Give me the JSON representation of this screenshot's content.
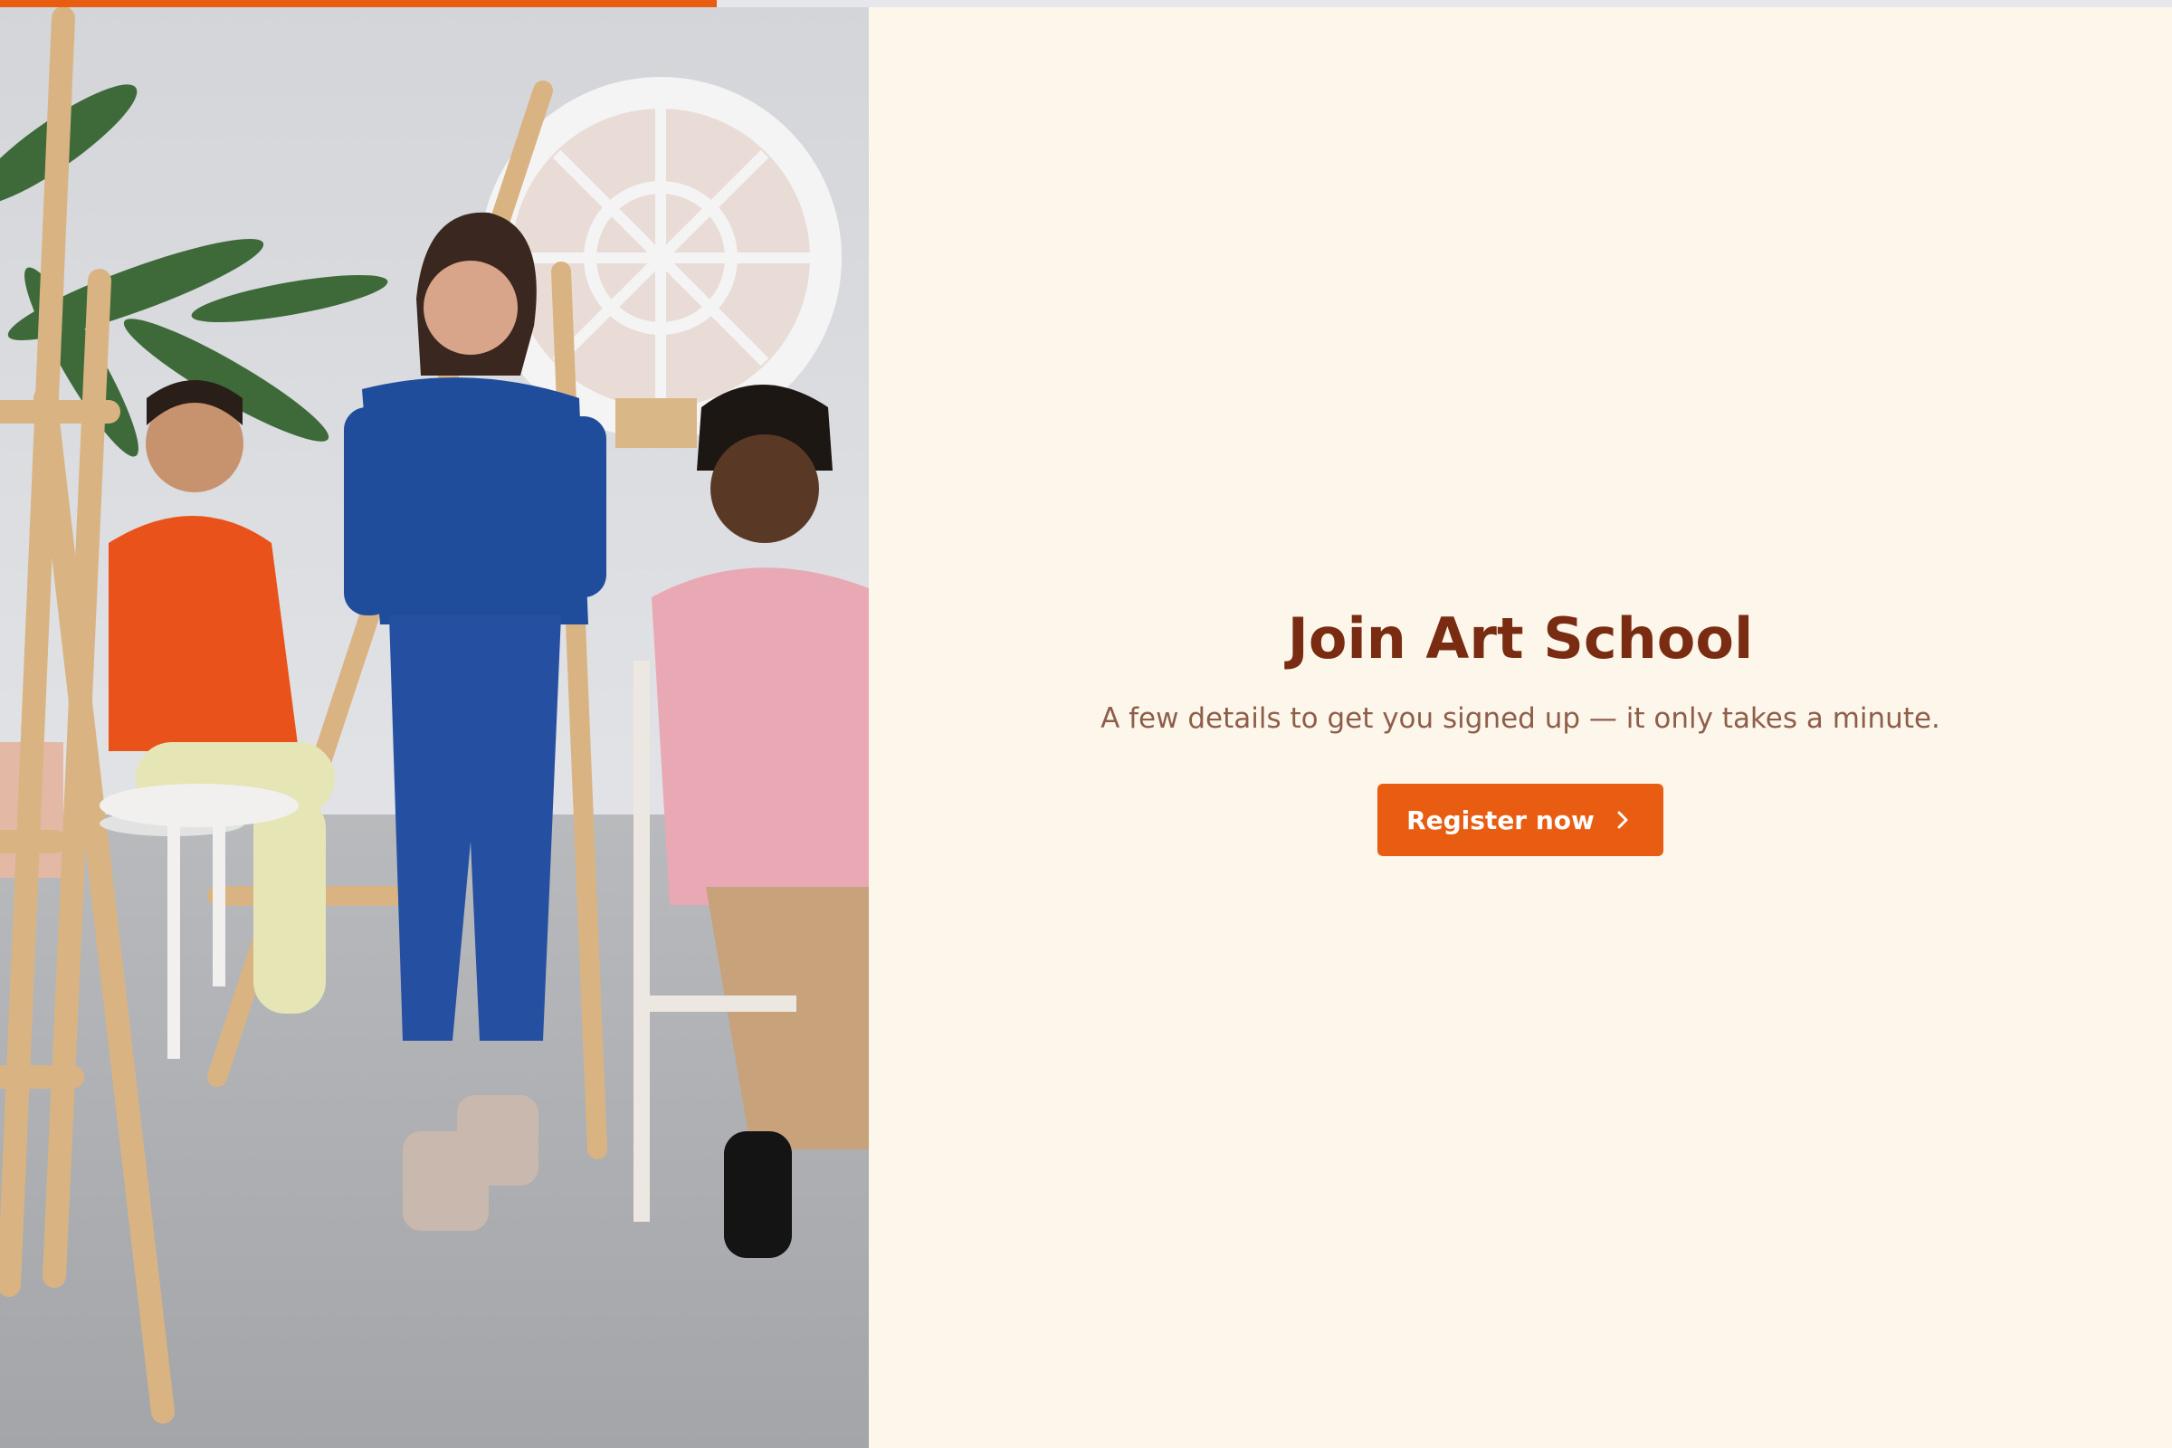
{
  "progress": {
    "percent": 33,
    "color": "#e85d12"
  },
  "photo": {
    "icons": {
      "teacher": "teacher-figure",
      "boy": "student-boy-figure",
      "girl": "student-girl-figure",
      "window": "round-window",
      "plant": "palm-plant"
    }
  },
  "hero": {
    "title": "Join Art School",
    "subtitle": "A few details to get you signed up — it only takes a minute.",
    "cta_label": "Register now",
    "cta_icon": "chevron-right-icon"
  },
  "colors": {
    "accent": "#e85d12",
    "title": "#7a2c12",
    "subtitle": "#8f5e4a",
    "background": "#fdf6eb"
  }
}
